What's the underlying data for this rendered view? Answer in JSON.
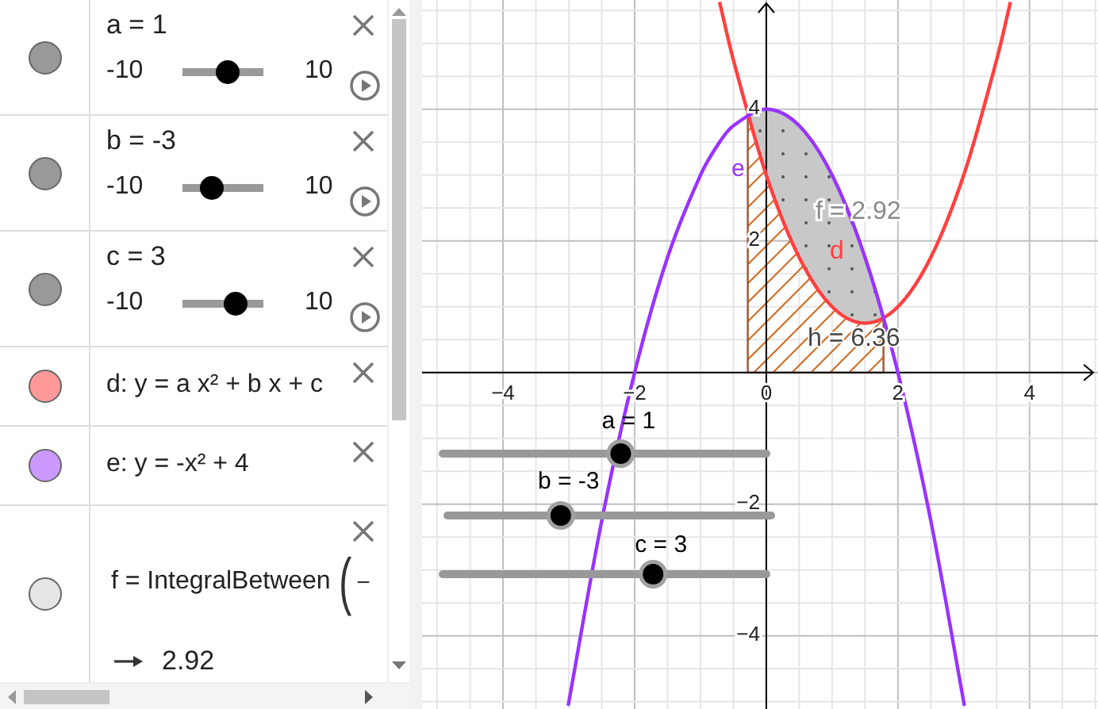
{
  "algebra": {
    "items": [
      {
        "kind": "slider",
        "color": "#999999",
        "label": "a = 1",
        "min": "-10",
        "max": "10",
        "level": 0.55
      },
      {
        "kind": "slider",
        "color": "#999999",
        "label": "b = -3",
        "min": "-10",
        "max": "10",
        "level": 0.35
      },
      {
        "kind": "slider",
        "color": "#999999",
        "label": "c = 3",
        "min": "-10",
        "max": "10",
        "level": 0.65
      },
      {
        "kind": "function",
        "color": "#ff9999",
        "text": "d: y = a x² + b x + c"
      },
      {
        "kind": "function",
        "color": "#cc99ff",
        "text": "e: y = -x² + 4"
      },
      {
        "kind": "integral",
        "color": "#e5e5e5",
        "formula": "f = IntegralBetween",
        "bracket": "(",
        "argument": "−",
        "result": "2.92"
      }
    ]
  },
  "graph": {
    "chart_data": {
      "type": "line",
      "grid": true,
      "xlim": [
        -5.23,
        5.04
      ],
      "ylim": [
        -5.11,
        5.66
      ],
      "x": [
        -3.01,
        -2.5,
        -2,
        -1.5,
        -1,
        -0.71,
        -0.5,
        0,
        0.5,
        1,
        1.5,
        2,
        2.5,
        3.01,
        3.5,
        3.71
      ],
      "series": [
        {
          "name": "d",
          "color": "#ff4040",
          "values": [
            null,
            null,
            null,
            null,
            null,
            5.63,
            4.75,
            3,
            1.75,
            1,
            0.75,
            1,
            1.75,
            3.03,
            4.75,
            5.63
          ]
        },
        {
          "name": "e",
          "color": "#9933ff",
          "values": [
            -5.06,
            -2.25,
            0,
            1.75,
            3,
            3.5,
            3.75,
            4,
            3.75,
            3,
            1.75,
            0,
            -2.25,
            -5.06,
            null,
            null
          ]
        }
      ],
      "xticks": [
        {
          "value": -4,
          "label": "−4"
        },
        {
          "value": -2,
          "label": "−2"
        },
        {
          "value": 0,
          "label": "0"
        },
        {
          "value": 2,
          "label": "2"
        },
        {
          "value": 4,
          "label": "4"
        }
      ],
      "yticks": [
        {
          "value": 4,
          "label": "4"
        },
        {
          "value": 2,
          "label": "2"
        },
        {
          "value": -2,
          "label": "−2"
        },
        {
          "value": -4,
          "label": "−4"
        }
      ]
    },
    "value_f": "f = 2.92",
    "value_h": "h = 6.36",
    "sliders": [
      {
        "label": "a = 1",
        "level": 0.55
      },
      {
        "label": "b = -3",
        "level": 0.35
      },
      {
        "label": "c = 3",
        "level": 0.65
      }
    ]
  }
}
